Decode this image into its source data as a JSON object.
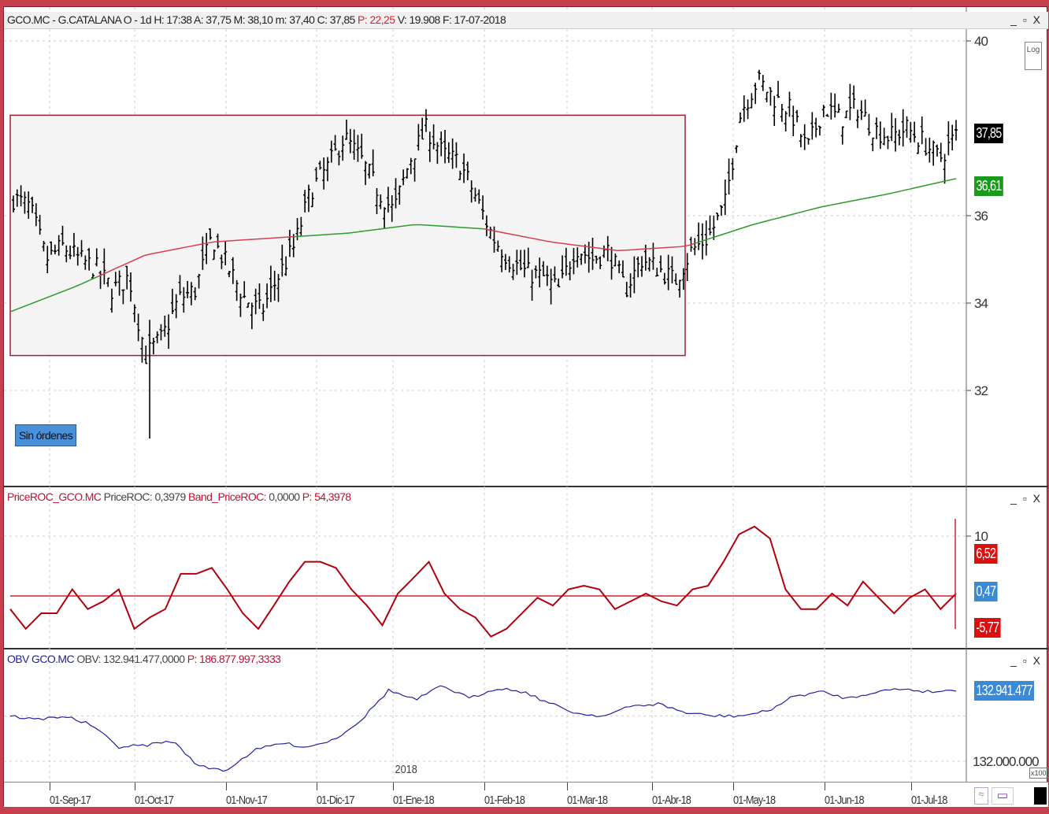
{
  "header": {
    "symbol": "GCO.MC - G.CATALANA O - 1d",
    "h": "H: 17:38",
    "a": "A: 37,75",
    "m": "M: 38,10",
    "mn": "m: 37,40",
    "c": "C: 37,85",
    "p_label": "P",
    "p_value": ": 22,25",
    "v": "V: 19.908",
    "f": "F: 17-07-2018"
  },
  "window_buttons": "_ ▫ X",
  "orders_label": "Sin órdenes",
  "log_button": "Log",
  "roc_header": {
    "name": "PriceROC_GCO.MC",
    "roc": "PriceROC: 0,3979",
    "band_label": "Band_PriceROC:",
    "band_value": " 0,0000",
    "p": "P: 54,3978"
  },
  "obv_header": {
    "name": "OBV GCO.MC",
    "obv": "OBV: 132.941.477,0000",
    "p": "P: 186.877.997,3333"
  },
  "year_label": "2018",
  "x100_label": "x100",
  "colors": {
    "price": "#000000",
    "ma_above": "#2a9a2a",
    "ma_below": "#d04050",
    "roc": "#b00010",
    "obv": "#2020a0",
    "box": "#a02030"
  },
  "chart_data": [
    {
      "type": "bar",
      "title": "GCO.MC daily OHLC",
      "ylim": [
        30.6,
        40.5
      ],
      "yticks": [
        "40",
        "36",
        "34",
        "32"
      ],
      "ytick_values": [
        40,
        36,
        34,
        32
      ],
      "x_ticks": [
        "01-Sep-17",
        "01-Oct-17",
        "01-Nov-17",
        "01-Dic-17",
        "01-Ene-18",
        "01-Feb-18",
        "01-Mar-18",
        "01-Abr-18",
        "01-May-18",
        "01-Jun-18",
        "01-Jul-18"
      ],
      "closes": [
        36.4,
        36.2,
        35.0,
        35.3,
        35.0,
        34.8,
        34.3,
        34.6,
        32.8,
        33.2,
        34.1,
        34.3,
        35.5,
        34.8,
        34.1,
        33.8,
        34.6,
        35.3,
        36.6,
        37.1,
        37.8,
        37.3,
        36.6,
        36.1,
        37.3,
        38.0,
        37.4,
        37.2,
        36.4,
        35.5,
        35.0,
        34.7,
        34.6,
        34.3,
        35.3,
        35.0,
        35.2,
        34.3,
        35.0,
        34.8,
        34.5,
        35.2,
        35.5,
        36.2,
        38.4,
        39.1,
        38.7,
        38.4,
        37.5,
        38.5,
        38.2,
        38.5,
        38.0,
        37.8,
        38.0,
        37.7,
        37.3,
        37.85
      ],
      "moving_average": [
        33.8,
        34.4,
        35.1,
        35.4,
        35.5,
        35.6,
        35.8,
        35.7,
        35.4,
        35.2,
        35.3,
        35.8,
        36.2,
        36.5,
        36.85
      ],
      "range_box": {
        "top": 38.3,
        "bottom": 32.8
      },
      "last_price": "37,85",
      "ma_value": "36,61"
    },
    {
      "type": "line",
      "title": "PriceROC",
      "ylim": [
        -10,
        12
      ],
      "yticks": [
        "10",
        "10"
      ],
      "band": 0,
      "values": [
        -2.2,
        -5.5,
        -2.9,
        -2.9,
        1.1,
        -2.2,
        -0.9,
        1.1,
        -5.5,
        -3.6,
        -2.2,
        3.7,
        3.7,
        4.7,
        1.1,
        -2.9,
        -5.5,
        -1.6,
        2.4,
        5.7,
        5.7,
        4.7,
        1.1,
        -1.6,
        -4.9,
        0.4,
        3.0,
        5.7,
        0.4,
        -2.2,
        -3.6,
        -6.8,
        -5.5,
        -2.9,
        -0.3,
        -1.6,
        1.1,
        1.7,
        1.1,
        -2.2,
        -0.9,
        0.4,
        -0.9,
        -1.6,
        1.1,
        1.7,
        5.7,
        10.3,
        11.6,
        9.6,
        1.1,
        -2.2,
        -2.2,
        0.4,
        -1.6,
        2.4,
        -0.3,
        -2.9,
        -0.3,
        1.1,
        -2.2,
        0.4
      ],
      "tags": [
        "6,52",
        "0,47",
        "-5,77"
      ]
    },
    {
      "type": "line",
      "title": "OBV",
      "ylabel_unit": "x100",
      "ytick": "132.000.000",
      "ylim_millions": [
        131.7,
        133.3
      ],
      "values_millions": [
        132.6,
        132.55,
        132.6,
        132.48,
        132.19,
        132.21,
        132.27,
        131.93,
        131.88,
        132.14,
        132.24,
        132.19,
        132.29,
        132.55,
        132.94,
        132.81,
        133.0,
        132.83,
        132.97,
        132.92,
        132.76,
        132.63,
        132.6,
        132.73,
        132.76,
        132.64,
        132.6,
        132.6,
        132.66,
        132.86,
        132.92,
        132.83,
        132.92,
        132.96,
        132.92,
        132.94
      ],
      "last": "132.941.477"
    }
  ]
}
